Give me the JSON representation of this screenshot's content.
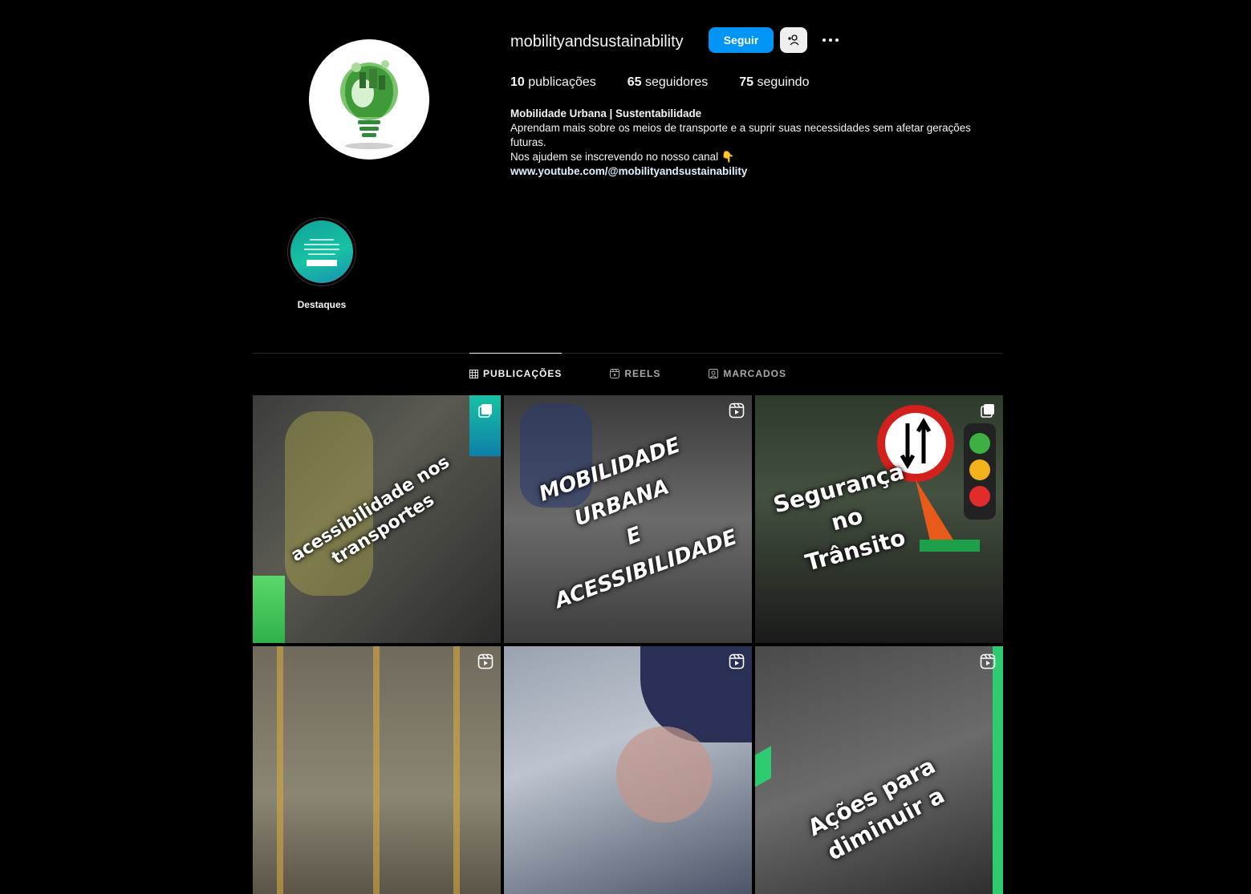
{
  "profile": {
    "username": "mobilityandsustainability",
    "follow_label": "Seguir",
    "suggest_icon": "add-person-icon",
    "more_icon": "ellipsis-icon"
  },
  "stats": {
    "posts_count": "10",
    "posts_label": "publicações",
    "followers_count": "65",
    "followers_label": "seguidores",
    "following_count": "75",
    "following_label": "seguindo"
  },
  "bio": {
    "full_name": "Mobilidade Urbana | Sustentabilidade",
    "line1": "Aprendam mais sobre os meios de transporte e a suprir suas necessidades sem afetar gerações futuras.",
    "line2": "Nos ajudem se inscrevendo no nosso canal 👇",
    "link": "www.youtube.com/@mobilityandsustainability"
  },
  "highlights": [
    {
      "label": "Destaques"
    }
  ],
  "tabs": [
    {
      "label": "PUBLICAÇÕES",
      "icon": "grid-icon",
      "active": true
    },
    {
      "label": "REELS",
      "icon": "reels-icon",
      "active": false
    },
    {
      "label": "MARCADOS",
      "icon": "tagged-icon",
      "active": false
    }
  ],
  "posts": [
    {
      "caption_line1": "acessibilidade nos",
      "caption_line2": "transportes",
      "type": "carousel"
    },
    {
      "caption_line1": "MOBILIDADE URBANA",
      "caption_line2": "E",
      "caption_line3": "ACESSIBILIDADE",
      "type": "reel"
    },
    {
      "caption_line1": "Segurança",
      "caption_line2": "no",
      "caption_line3": "Trânsito",
      "type": "carousel"
    },
    {
      "type": "reel"
    },
    {
      "type": "reel"
    },
    {
      "caption_line1": "Ações para",
      "caption_line2": "diminuir a",
      "type": "reel"
    }
  ],
  "colors": {
    "accent": "#0095f6",
    "background": "#000000",
    "highlight_teal": "#18c2a3",
    "post_green": "#2ecc71"
  }
}
